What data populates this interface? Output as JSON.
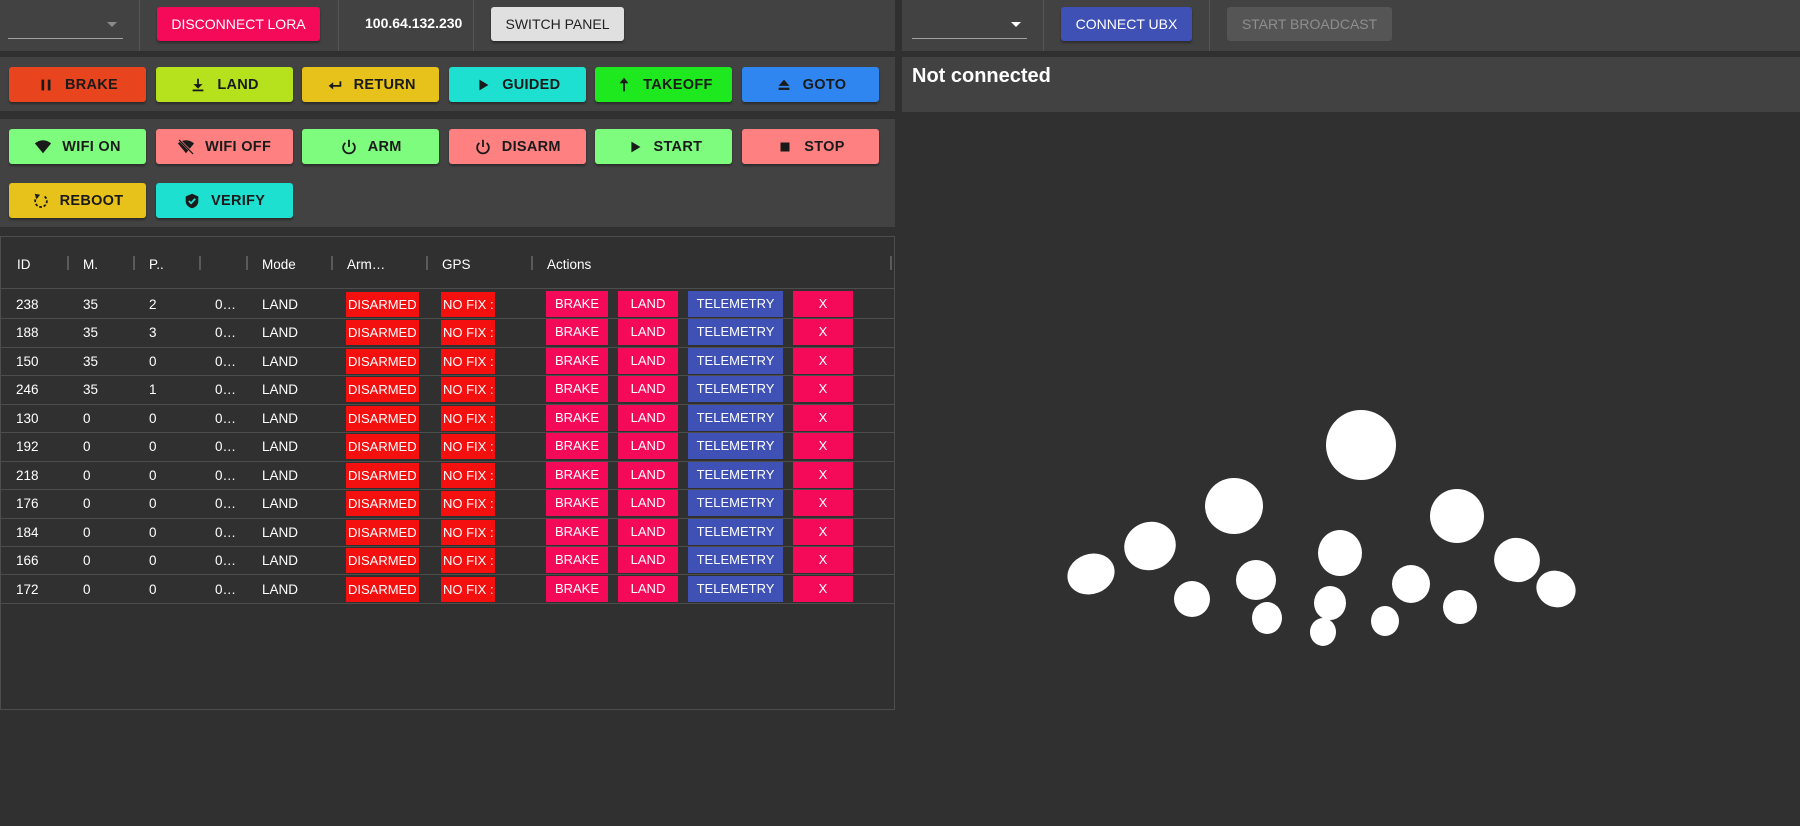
{
  "colors": {
    "magenta": "#f50a5a",
    "indigo": "#3f51b5",
    "disarmed_red": "#f51010"
  },
  "lora": {
    "select_value": "",
    "disconnect_label": "DISCONNECT LORA",
    "ip": "100.64.132.230",
    "switch_label": "SWITCH PANEL"
  },
  "ubx": {
    "select_value": "",
    "connect_label": "CONNECT UBX",
    "broadcast_label": "START BROADCAST",
    "status": "Not connected"
  },
  "commands_row1": [
    {
      "label": "BRAKE",
      "icon": "pause-icon",
      "color": "#e8441e"
    },
    {
      "label": "LAND",
      "icon": "download-icon",
      "color": "#b5e21c"
    },
    {
      "label": "RETURN",
      "icon": "return-icon",
      "color": "#e6c21a"
    },
    {
      "label": "GUIDED",
      "icon": "play-icon",
      "color": "#1de0d0"
    },
    {
      "label": "TAKEOFF",
      "icon": "arrow-up-icon",
      "color": "#1ee81e"
    },
    {
      "label": "GOTO",
      "icon": "eject-icon",
      "color": "#2f86f0"
    }
  ],
  "commands_row2": [
    {
      "label": "WIFI ON",
      "icon": "wifi-icon",
      "color": "#7dfc7d"
    },
    {
      "label": "WIFI OFF",
      "icon": "wifi-off-icon",
      "color": "#ff8080"
    },
    {
      "label": "ARM",
      "icon": "power-icon",
      "color": "#7dfc7d"
    },
    {
      "label": "DISARM",
      "icon": "power-icon",
      "color": "#ff8080"
    },
    {
      "label": "START",
      "icon": "play-icon",
      "color": "#7dfc7d"
    },
    {
      "label": "STOP",
      "icon": "stop-icon",
      "color": "#ff8080"
    }
  ],
  "commands_row3": [
    {
      "label": "REBOOT",
      "icon": "reboot-icon",
      "color": "#e6c21a"
    },
    {
      "label": "VERIFY",
      "icon": "shield-check-icon",
      "color": "#1de0d0"
    }
  ],
  "table": {
    "headers": [
      "ID",
      "M.",
      "P..",
      "",
      "Mode",
      "Arm…",
      "GPS",
      "Actions"
    ],
    "action_labels": {
      "brake": "BRAKE",
      "land": "LAND",
      "telemetry": "TELEMETRY",
      "remove": "X"
    },
    "rows": [
      {
        "id": "238",
        "m": "35",
        "p": "2",
        "x": "0…",
        "mode": "LAND",
        "arm": "DISARMED",
        "gps": "NO FIX :"
      },
      {
        "id": "188",
        "m": "35",
        "p": "3",
        "x": "0…",
        "mode": "LAND",
        "arm": "DISARMED",
        "gps": "NO FIX :"
      },
      {
        "id": "150",
        "m": "35",
        "p": "0",
        "x": "0…",
        "mode": "LAND",
        "arm": "DISARMED",
        "gps": "NO FIX :"
      },
      {
        "id": "246",
        "m": "35",
        "p": "1",
        "x": "0…",
        "mode": "LAND",
        "arm": "DISARMED",
        "gps": "NO FIX :"
      },
      {
        "id": "130",
        "m": "0",
        "p": "0",
        "x": "0…",
        "mode": "LAND",
        "arm": "DISARMED",
        "gps": "NO FIX :"
      },
      {
        "id": "192",
        "m": "0",
        "p": "0",
        "x": "0…",
        "mode": "LAND",
        "arm": "DISARMED",
        "gps": "NO FIX :"
      },
      {
        "id": "218",
        "m": "0",
        "p": "0",
        "x": "0…",
        "mode": "LAND",
        "arm": "DISARMED",
        "gps": "NO FIX :"
      },
      {
        "id": "176",
        "m": "0",
        "p": "0",
        "x": "0…",
        "mode": "LAND",
        "arm": "DISARMED",
        "gps": "NO FIX :"
      },
      {
        "id": "184",
        "m": "0",
        "p": "0",
        "x": "0…",
        "mode": "LAND",
        "arm": "DISARMED",
        "gps": "NO FIX :"
      },
      {
        "id": "166",
        "m": "0",
        "p": "0",
        "x": "0…",
        "mode": "LAND",
        "arm": "DISARMED",
        "gps": "NO FIX :"
      },
      {
        "id": "172",
        "m": "0",
        "p": "0",
        "x": "0…",
        "mode": "LAND",
        "arm": "DISARMED",
        "gps": "NO FIX :"
      }
    ]
  }
}
